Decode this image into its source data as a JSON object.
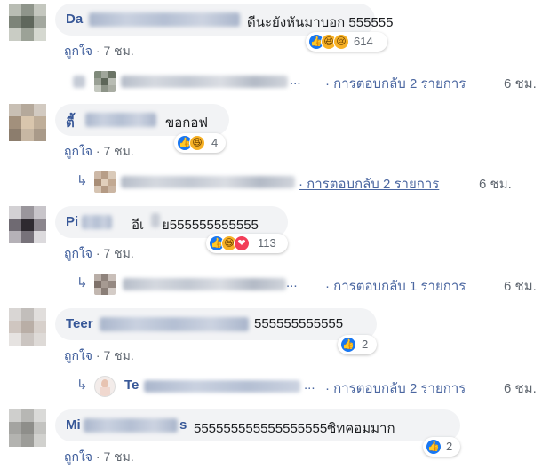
{
  "comments": [
    {
      "name_visible": "Da",
      "text": "ดีนะยังหันมาบอก 555555",
      "reaction_count": "614",
      "like_label": "ถูกใจ",
      "time": "7 ชม.",
      "reply": {
        "dots": "...",
        "link": "· การตอบกลับ 2 รายการ",
        "time": "6 ชม."
      }
    },
    {
      "name_visible": "ตี้",
      "text": "ขอกอฟ",
      "reaction_count": "4",
      "like_label": "ถูกใจ",
      "time": "7 ชม.",
      "reply": {
        "dots": "",
        "link": "· การตอบกลับ 2 รายการ",
        "time": "6 ชม."
      }
    },
    {
      "name_visible": "Pi",
      "text": "อีเ",
      "text2": "ย555555555555",
      "reaction_count": "113",
      "like_label": "ถูกใจ",
      "time": "7 ชม.",
      "reply": {
        "dots": "...",
        "link": "· การตอบกลับ 1 รายการ",
        "time": "6 ชม."
      }
    },
    {
      "name_visible": "Teer",
      "text": "555555555555",
      "reaction_count": "2",
      "like_label": "ถูกใจ",
      "time": "7 ชม.",
      "reply": {
        "name_visible": "Te",
        "dots": "...",
        "link": "· การตอบกลับ 2 รายการ",
        "time": "6 ชม."
      }
    },
    {
      "name_visible": "Mi",
      "name_tail": "s",
      "text": "555555555555555555ซิทคอมมาก",
      "reaction_count": "2",
      "like_label": "ถูกใจ",
      "time": "7 ชม."
    }
  ],
  "colors": {
    "link": "#385898",
    "bubble": "#f2f3f5",
    "meta": "#606770",
    "like": "#1877f2"
  },
  "icons": [
    "like-icon",
    "haha-icon",
    "sad-icon",
    "love-icon",
    "reply-arrow-icon"
  ]
}
